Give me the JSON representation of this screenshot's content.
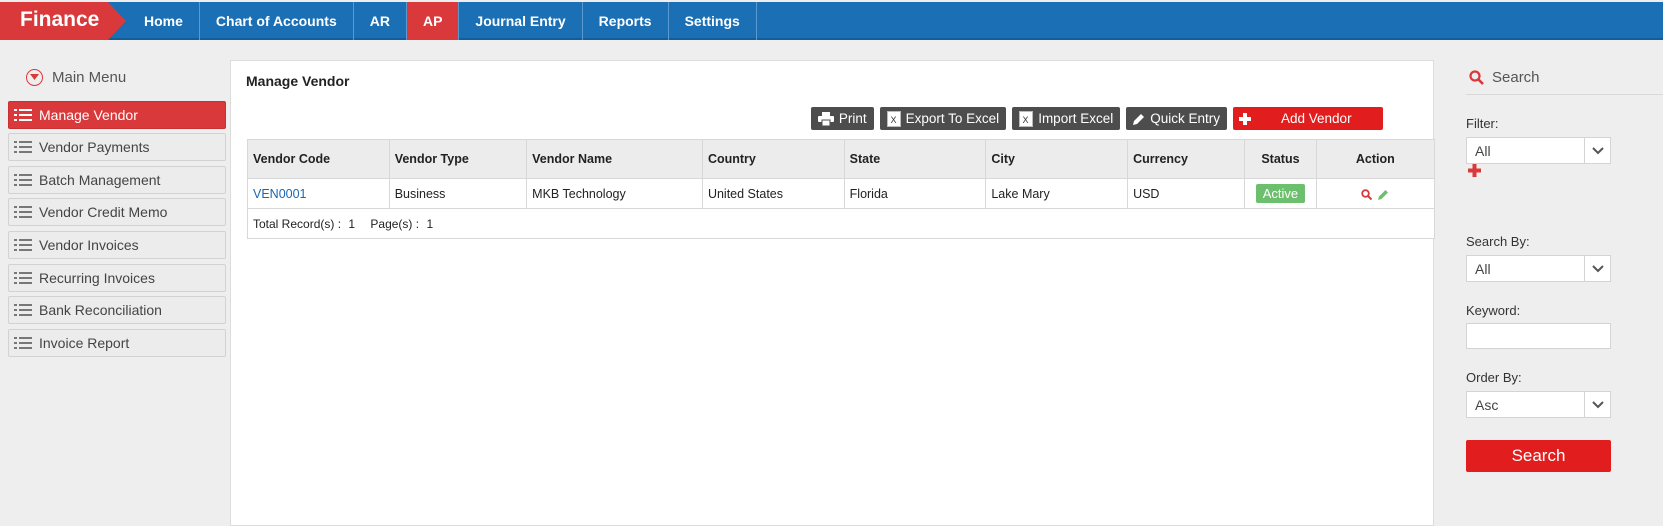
{
  "brand": "Finance",
  "nav": {
    "items": [
      {
        "label": "Home",
        "active": false
      },
      {
        "label": "Chart of Accounts",
        "active": false
      },
      {
        "label": "AR",
        "active": false
      },
      {
        "label": "AP",
        "active": true
      },
      {
        "label": "Journal Entry",
        "active": false
      },
      {
        "label": "Reports",
        "active": false
      },
      {
        "label": "Settings",
        "active": false
      }
    ]
  },
  "sidebar": {
    "title": "Main Menu",
    "items": [
      {
        "label": "Manage Vendor",
        "active": true
      },
      {
        "label": "Vendor Payments",
        "active": false
      },
      {
        "label": "Batch Management",
        "active": false
      },
      {
        "label": "Vendor Credit Memo",
        "active": false
      },
      {
        "label": "Vendor Invoices",
        "active": false
      },
      {
        "label": "Recurring Invoices",
        "active": false
      },
      {
        "label": "Bank Reconciliation",
        "active": false
      },
      {
        "label": "Invoice Report",
        "active": false
      }
    ]
  },
  "main": {
    "title": "Manage Vendor",
    "toolbar": {
      "print": "Print",
      "export": "Export To Excel",
      "import": "Import Excel",
      "quick": "Quick Entry",
      "add": "Add Vendor"
    },
    "table": {
      "columns": [
        "Vendor Code",
        "Vendor Type",
        "Vendor Name",
        "Country",
        "State",
        "City",
        "Currency",
        "Status",
        "Action"
      ],
      "rows": [
        {
          "code": "VEN0001",
          "type": "Business",
          "name": "MKB Technology",
          "country": "United States",
          "state": "Florida",
          "city": "Lake Mary",
          "currency": "USD",
          "status": "Active"
        }
      ],
      "footer": {
        "records_label": "Total Record(s) :",
        "records_value": "1",
        "pages_label": "Page(s) :",
        "pages_value": "1"
      }
    }
  },
  "search_panel": {
    "title": "Search",
    "filter_label": "Filter:",
    "filter_value": "All",
    "search_by_label": "Search By:",
    "search_by_value": "All",
    "keyword_label": "Keyword:",
    "keyword_value": "",
    "order_by_label": "Order By:",
    "order_by_value": "Asc",
    "button": "Search"
  },
  "colors": {
    "nav_blue": "#1a6fb5",
    "accent_red": "#d9393b",
    "button_red": "#e21d1d",
    "active_green": "#6cbf6c"
  }
}
